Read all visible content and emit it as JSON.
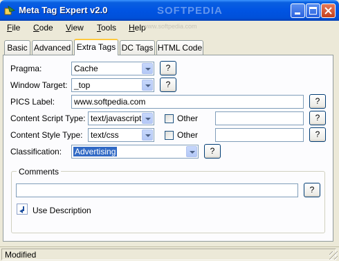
{
  "window": {
    "title": "Meta Tag Expert v2.0",
    "watermark": "SOFTPEDIA"
  },
  "menu": {
    "items": [
      "File",
      "Code",
      "View",
      "Tools",
      "Help"
    ],
    "subtext": "www.softpedia.com"
  },
  "tabs": [
    "Basic",
    "Advanced",
    "Extra Tags",
    "DC Tags",
    "HTML Code"
  ],
  "active_tab": "Extra Tags",
  "form": {
    "pragma": {
      "label": "Pragma:",
      "value": "Cache"
    },
    "window_target": {
      "label": "Window Target:",
      "value": "_top"
    },
    "pics_label": {
      "label": "PICS Label:",
      "value": "www.softpedia.com"
    },
    "content_script": {
      "label": "Content Script Type:",
      "value": "text/javascript",
      "other_label": "Other",
      "other_value": ""
    },
    "content_style": {
      "label": "Content Style Type:",
      "value": "text/css",
      "other_label": "Other",
      "other_value": ""
    },
    "classification": {
      "label": "Classification:",
      "value": "Advertising"
    },
    "help_label": "?"
  },
  "comments": {
    "title": "Comments",
    "value": "",
    "use_description_label": "Use Description"
  },
  "status": {
    "text": "Modified"
  },
  "colors": {
    "title_blue": "#0054E3",
    "selection": "#316AC5",
    "tab_highlight": "#FFC83C",
    "face": "#ECE9D8"
  },
  "icons": [
    "app-icon",
    "minimize-icon",
    "maximize-icon",
    "close-icon",
    "dropdown-arrow-icon",
    "help-icon",
    "use-description-icon",
    "size-grip-icon"
  ]
}
